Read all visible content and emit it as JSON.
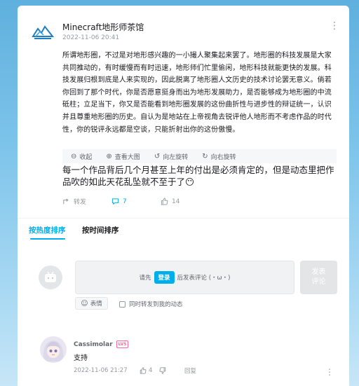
{
  "post": {
    "author": "Minecraft地形师茶馆",
    "time": "2022-11-06 20:41",
    "logo_icon": "mountain-logo",
    "text": "所谓地形圈，不过是对地形感兴趣的一小撮人聚集起来罢了。地形圈的科技发展是大家共同推动的，有时缓慢而有时迅速，地形师们忙里偷闲，地形科技就能更快的发展。科技发展归根到底是人来实现的，因此脱离了地形圈人文历史的技术讨论罢无意义。倘若你回到了那个时代，你是否愿意挺身而出为地形发展助力，是否能够成为地形圈的中流砥柱；立足当下，你又是否能看到地形圈发展的这份曲折性与进步性的辩证统一，认识并且尊重地形圈的历史。自认为是地站在上帝视角去锐评他人地形而不考虑作品的时代性，你的锐评永远都是空谈，只能折射出你的这份傲慢。",
    "image_toolbar": {
      "collapse": "收起",
      "view_large": "查看大图",
      "rotate_left": "向左旋转",
      "rotate_right": "向右旋转"
    },
    "image_caption": "每一个作品背后几个月甚至上年的付出是必须肯定的，但是动态里把作品吹的如此天花乱坠就不至于了😶",
    "forward_label": "转发",
    "comment_count": "7",
    "like_count": "14"
  },
  "sort_tabs": {
    "hot": "按热度排序",
    "time": "按时间排序"
  },
  "composer": {
    "prompt_before": "请先",
    "login_label": "登录",
    "prompt_after": "后发表评论 (・ω・)",
    "submit_label": "发表\n评论",
    "emoji_label": "表情",
    "sync_label": "同时转发到我的动态"
  },
  "comments": [
    {
      "user": "Cassimolar",
      "level": "LV5",
      "text": "支持",
      "time": "2022-11-06 21:27",
      "likes": "4",
      "reply_label": "回复"
    }
  ],
  "colors": {
    "accent": "#00aeec",
    "level": "#ff6699"
  }
}
